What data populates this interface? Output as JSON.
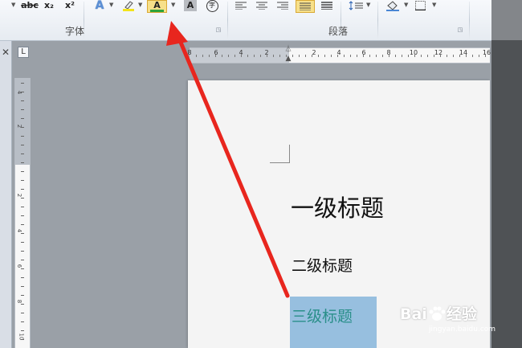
{
  "ribbon": {
    "font_group_label": "字体",
    "paragraph_group_label": "段落",
    "strikethrough_label": "abc",
    "subscript_label": "x₂",
    "superscript_label": "x²",
    "text_effect_label": "A",
    "font_color_label": "A",
    "char_shading_label": "A",
    "enclose_char_label": "字",
    "colors": {
      "highlight": "#f3e41b",
      "font_color_bar": "#2ea33b",
      "active_button": "#f7e08a",
      "text_effect": "#5b8fd5"
    }
  },
  "document": {
    "heading1": "一级标题",
    "heading2": "二级标题",
    "heading3": "三级标题",
    "heading3_color": "#2a8f8a",
    "selection_color": "#97bfdf"
  },
  "ruler": {
    "h_numbers": [
      "8",
      "6",
      "4",
      "2",
      "2",
      "4",
      "6",
      "8",
      "10",
      "12",
      "14",
      "16"
    ],
    "v_numbers": [
      "4",
      "2",
      "2",
      "4",
      "6",
      "8",
      "10"
    ]
  },
  "watermark": {
    "brand": "Bai",
    "brand_end": "经验",
    "url": "jingyan.baidu.com"
  },
  "annotation": {
    "arrow_color": "#e8261e"
  }
}
